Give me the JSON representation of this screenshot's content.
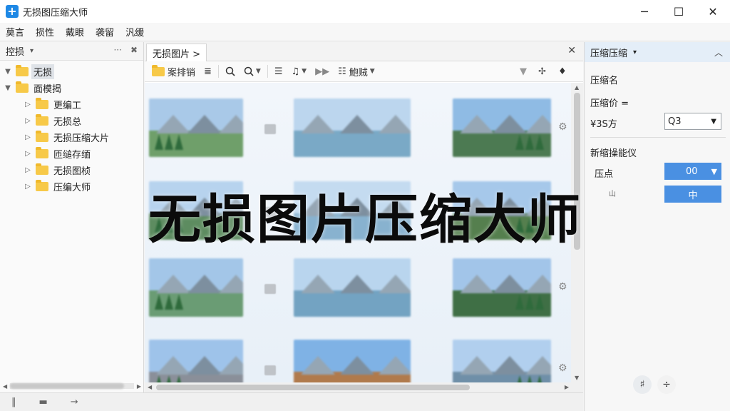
{
  "window": {
    "title": "无损图压缩大师",
    "app_icon_glyph": "+",
    "minimize": "─",
    "maximize": "☐",
    "close": "✕"
  },
  "menu": [
    "莫言",
    "损性",
    "戴眼",
    "袭留",
    "汎缓"
  ],
  "left_panel": {
    "title": "控损",
    "tools": [
      "···",
      "✖"
    ],
    "tree": [
      {
        "label": "无损",
        "expanded": true,
        "selected": true,
        "indent": 0
      },
      {
        "label": "面模揭",
        "expanded": true,
        "selected": false,
        "indent": 0
      },
      {
        "label": "更编工",
        "expanded": false,
        "selected": false,
        "indent": 1
      },
      {
        "label": "无损总",
        "expanded": false,
        "selected": false,
        "indent": 1
      },
      {
        "label": "无损压缩大片",
        "expanded": false,
        "selected": false,
        "indent": 1
      },
      {
        "label": "匝缒存缅",
        "expanded": false,
        "selected": false,
        "indent": 1
      },
      {
        "label": "无损图桢",
        "expanded": false,
        "selected": false,
        "indent": 1
      },
      {
        "label": "压编大师",
        "expanded": false,
        "selected": false,
        "indent": 1
      }
    ]
  },
  "center": {
    "tab_label": "无损图片 >",
    "tab_close": "✕",
    "toolbar": {
      "folder_label": "案排销",
      "sort_glyph": "≣",
      "view_label": "鮑贼"
    }
  },
  "right_panel": {
    "title": "压缩压缩",
    "row1": "压缩名",
    "row2": "压缩价  =",
    "row3_label": "¥3S方",
    "quality_value": "Q3",
    "section_title": "新缩操能仪",
    "point_label": "压点",
    "point_value": "00",
    "button_label": "中",
    "mini_label": "山"
  },
  "banner": {
    "text": "无损图片压缩大师"
  },
  "colors": {
    "accent": "#4a90e2",
    "app_icon": "#1e88e5",
    "folder": "#f7c948"
  }
}
